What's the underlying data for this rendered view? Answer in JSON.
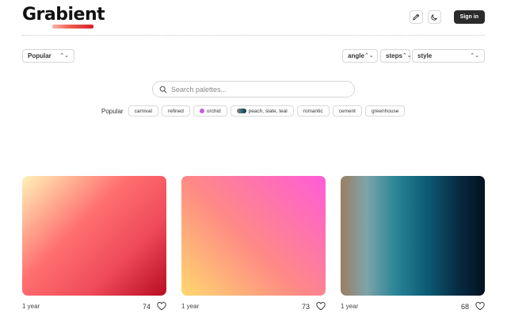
{
  "header": {
    "logo_text": "Grabient",
    "sign_in_label": "Sign in",
    "icons": [
      "eyedropper-icon",
      "moon-icon"
    ]
  },
  "filters": {
    "sort_value": "Popular",
    "angle_label": "angle",
    "steps_label": "steps",
    "style_label": "style"
  },
  "search": {
    "placeholder": "Search palettes..."
  },
  "tags": {
    "label": "Popular",
    "items": [
      "carnival",
      "refined",
      "orchid",
      "peach, slate, teal",
      "romantic",
      "cement",
      "greenhouse"
    ]
  },
  "palettes": [
    {
      "age": "1 year",
      "likes": "74"
    },
    {
      "age": "1 year",
      "likes": "73"
    },
    {
      "age": "1 year",
      "likes": "68"
    }
  ],
  "colors": {
    "logo_accent": "#d62030",
    "signin_bg": "#2b2b2b",
    "orchid_dot": "#c55ed8"
  }
}
